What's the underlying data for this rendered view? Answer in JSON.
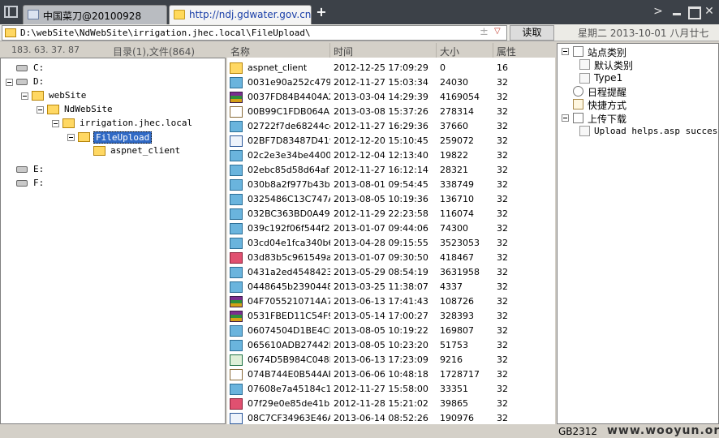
{
  "tabs": [
    {
      "label": "中国菜刀@20100928"
    },
    {
      "label": "http://ndj.gdwater.gov.cn/File..."
    }
  ],
  "address": {
    "path": "D:\\webSite\\NdWebSite\\irrigation.jhec.local\\FileUpload\\",
    "plus": "±",
    "dropdown": "▽"
  },
  "read_button": "读取",
  "date_text": "星期二 2013-10-01 八月廿七",
  "left_header": {
    "ip": "183. 63. 37. 87",
    "counts": "目录(1),文件(864)"
  },
  "tree": [
    {
      "label": "C:",
      "depth": 0,
      "icon": "drive",
      "expander": false
    },
    {
      "label": "D:",
      "depth": 0,
      "icon": "drive",
      "expander": true
    },
    {
      "label": "webSite",
      "depth": 1,
      "icon": "folder",
      "expander": true
    },
    {
      "label": "NdWebSite",
      "depth": 2,
      "icon": "folder",
      "expander": true
    },
    {
      "label": "irrigation.jhec.local",
      "depth": 3,
      "icon": "folder",
      "expander": true
    },
    {
      "label": "FileUpload",
      "depth": 4,
      "icon": "folder",
      "expander": true,
      "selected": true
    },
    {
      "label": "aspnet_client",
      "depth": 5,
      "icon": "folder",
      "expander": false
    },
    {
      "label": "E:",
      "depth": 0,
      "icon": "drive",
      "expander": false,
      "gap": true
    },
    {
      "label": "F:",
      "depth": 0,
      "icon": "drive",
      "expander": false
    }
  ],
  "columns": {
    "name": "名称",
    "time": "时间",
    "size": "大小",
    "attr": "属性"
  },
  "files": [
    {
      "name": "aspnet_client",
      "time": "2012-12-25 17:09:29",
      "size": "0",
      "attr": "16",
      "type": "folder"
    },
    {
      "name": "0031e90a252c479...",
      "time": "2012-11-27 15:03:34",
      "size": "24030",
      "attr": "32",
      "type": "jpg"
    },
    {
      "name": "0037FD84B4404A2...",
      "time": "2013-03-04 14:29:39",
      "size": "4169054",
      "attr": "32",
      "type": "rar"
    },
    {
      "name": "00B99C1FDB064A...",
      "time": "2013-03-08 15:37:26",
      "size": "278314",
      "attr": "32",
      "type": "edit"
    },
    {
      "name": "02722f7de68244cc...",
      "time": "2012-11-27 16:29:36",
      "size": "37660",
      "attr": "32",
      "type": "jpg"
    },
    {
      "name": "02BF7D83487D419...",
      "time": "2012-12-20 15:10:45",
      "size": "259072",
      "attr": "32",
      "type": "doc"
    },
    {
      "name": "02c2e3e34be4400...",
      "time": "2012-12-04 12:13:40",
      "size": "19822",
      "attr": "32",
      "type": "jpg"
    },
    {
      "name": "02ebc85d58d64af1...",
      "time": "2012-11-27 16:12:14",
      "size": "28321",
      "attr": "32",
      "type": "jpg"
    },
    {
      "name": "030b8a2f977b43bf...",
      "time": "2013-08-01 09:54:45",
      "size": "338749",
      "attr": "32",
      "type": "jpg"
    },
    {
      "name": "0325486C13C747A...",
      "time": "2013-08-05 10:19:36",
      "size": "136710",
      "attr": "32",
      "type": "jpg"
    },
    {
      "name": "032BC363BD0A49...",
      "time": "2012-11-29 22:23:58",
      "size": "116074",
      "attr": "32",
      "type": "jpg"
    },
    {
      "name": "039c192f06f544f2a...",
      "time": "2013-01-07 09:44:06",
      "size": "74300",
      "attr": "32",
      "type": "jpg"
    },
    {
      "name": "03cd04e1fca340b6...",
      "time": "2013-04-28 09:15:55",
      "size": "3523053",
      "attr": "32",
      "type": "jpg"
    },
    {
      "name": "03d83b5c961549af...",
      "time": "2013-01-07 09:30:50",
      "size": "418467",
      "attr": "32",
      "type": "png"
    },
    {
      "name": "0431a2ed4548423...",
      "time": "2013-05-29 08:54:19",
      "size": "3631958",
      "attr": "32",
      "type": "jpg"
    },
    {
      "name": "0448645b2390448...",
      "time": "2013-03-25 11:38:07",
      "size": "4337",
      "attr": "32",
      "type": "jpg"
    },
    {
      "name": "04F7055210714A7...",
      "time": "2013-06-13 17:41:43",
      "size": "108726",
      "attr": "32",
      "type": "rar"
    },
    {
      "name": "0531FBED11C54F9...",
      "time": "2013-05-14 17:00:27",
      "size": "328393",
      "attr": "32",
      "type": "rar"
    },
    {
      "name": "06074504D1BE4CF...",
      "time": "2013-08-05 10:19:22",
      "size": "169807",
      "attr": "32",
      "type": "jpg"
    },
    {
      "name": "065610ADB27442B...",
      "time": "2013-08-05 10:23:20",
      "size": "51753",
      "attr": "32",
      "type": "jpg"
    },
    {
      "name": "0674D5B984C048E...",
      "time": "2013-06-13 17:23:09",
      "size": "9216",
      "attr": "32",
      "type": "xls"
    },
    {
      "name": "074B744E0B544AF...",
      "time": "2013-06-06 10:48:18",
      "size": "1728717",
      "attr": "32",
      "type": "edit"
    },
    {
      "name": "07608e7a45184c1...",
      "time": "2012-11-27 15:58:00",
      "size": "33351",
      "attr": "32",
      "type": "jpg"
    },
    {
      "name": "07f29e0e85de41b8...",
      "time": "2012-11-28 15:21:02",
      "size": "39865",
      "attr": "32",
      "type": "png"
    },
    {
      "name": "08C7CF34963E46A...",
      "time": "2013-06-14 08:52:26",
      "size": "190976",
      "attr": "32",
      "type": "doc"
    }
  ],
  "side_tree": [
    {
      "label": "站点类别",
      "indent": 0,
      "expander": true,
      "icon": "box"
    },
    {
      "label": "默认类别",
      "indent": 1,
      "expander": false,
      "icon": "page"
    },
    {
      "label": "Type1",
      "indent": 1,
      "expander": false,
      "icon": "page"
    },
    {
      "label": "日程提醒",
      "indent": 0,
      "expander": false,
      "icon": "clock"
    },
    {
      "label": "快捷方式",
      "indent": 0,
      "expander": false,
      "icon": "hand"
    },
    {
      "label": "上传下载",
      "indent": 0,
      "expander": true,
      "icon": "box"
    },
    {
      "label": "Upload helps.asp succes",
      "indent": 1,
      "expander": false,
      "icon": "page",
      "mono": true
    }
  ],
  "status": {
    "encoding": "GB2312",
    "watermark": "www.wooyun.org"
  }
}
